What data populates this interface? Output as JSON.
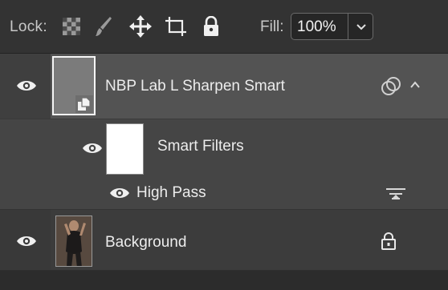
{
  "lock_bar": {
    "lock_label": "Lock:",
    "fill_label": "Fill:",
    "fill_value": "100%",
    "icons": [
      "lock-transparent-pixels-icon",
      "brush-icon",
      "move-icon",
      "artboard-icon",
      "padlock-icon"
    ]
  },
  "layers": {
    "smart_object": {
      "name": "NBP Lab L Sharpen Smart"
    },
    "smart_filters": {
      "name": "Smart Filters"
    },
    "high_pass": {
      "name": "High Pass"
    },
    "background": {
      "name": "Background"
    }
  },
  "colors": {
    "panel_bg": "#2b2b2b",
    "selected_row": "#535353",
    "text": "#ececec"
  }
}
